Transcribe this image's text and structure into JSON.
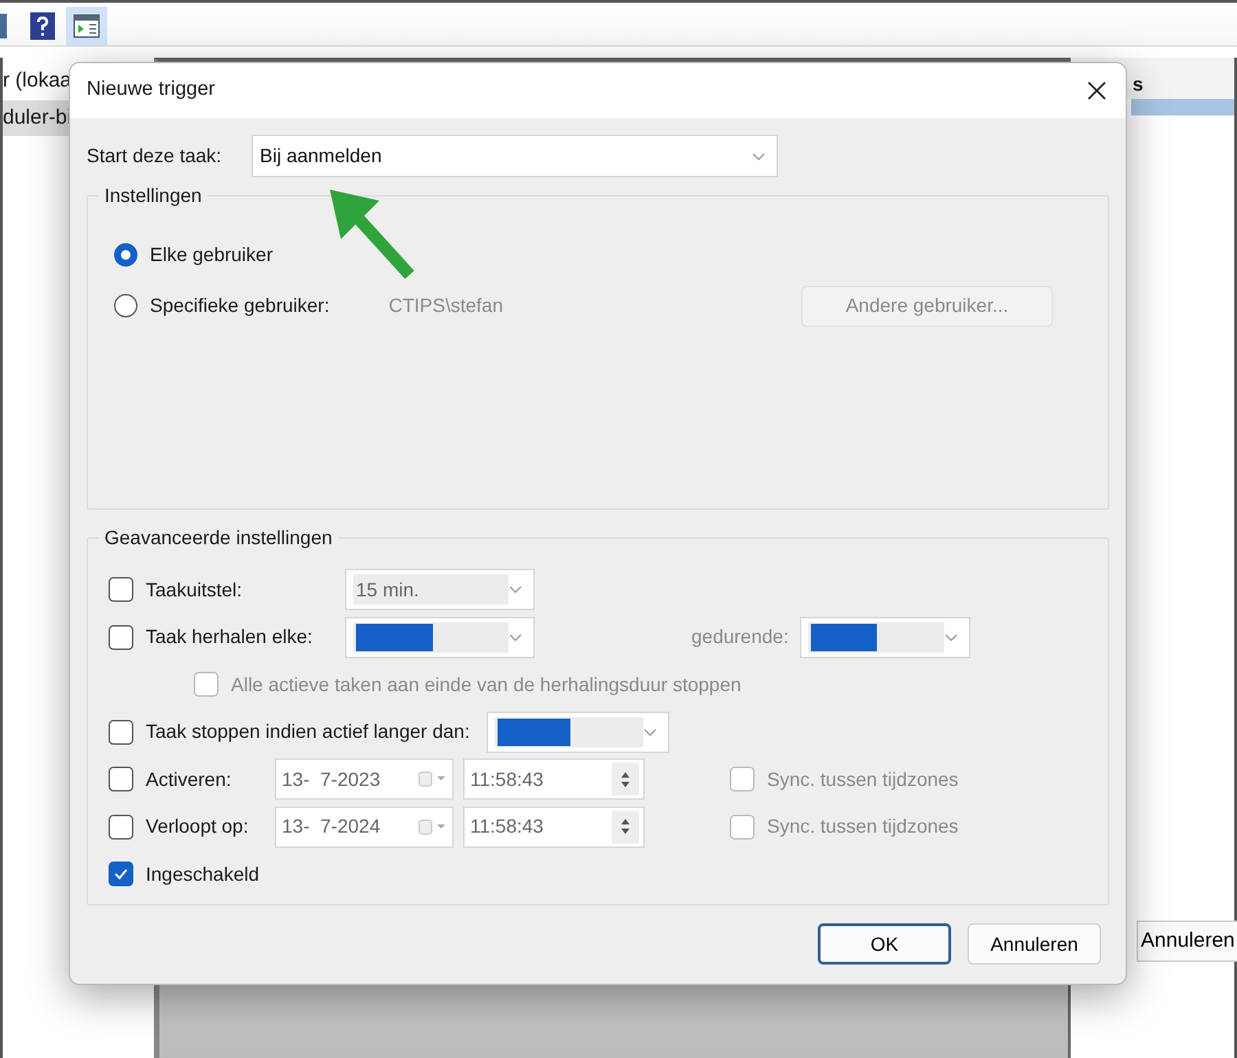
{
  "background_window": {
    "left_pane_items": [
      {
        "label": "r (lokaa",
        "selected": false
      },
      {
        "label": "duler-bi",
        "selected": true
      }
    ],
    "right_pane_header": "s",
    "right_button": "Annuleren"
  },
  "dialog": {
    "title": "Nieuwe trigger",
    "start": {
      "label": "Start deze taak:",
      "value": "Bij aanmelden"
    },
    "settings": {
      "legend": "Instellingen",
      "options": [
        {
          "label": "Elke gebruiker",
          "selected": true
        },
        {
          "label": "Specifieke gebruiker:",
          "selected": false
        }
      ],
      "user": "CTIPS\\stefan",
      "user_button": {
        "label": "Andere gebruiker...",
        "disabled": true
      }
    },
    "advanced": {
      "legend": "Geavanceerde instellingen",
      "rows": [
        {
          "kind": "select",
          "label": "Taakuitstel:",
          "checked": false,
          "value": "15 min.",
          "highlighted": false
        },
        {
          "kind": "repeat",
          "label": "Taak herhalen elke:",
          "checked": false,
          "highlighted": true,
          "duration_label": "gedurende:",
          "duration_highlighted": true
        },
        {
          "kind": "subcheck",
          "label": "Alle actieve taken aan einde van de herhalingsduur stoppen",
          "checked": false,
          "disabled": true
        },
        {
          "kind": "select",
          "label": "Taak stoppen indien actief langer dan:",
          "checked": false,
          "highlighted": true
        },
        {
          "kind": "datetime",
          "label": "Activeren:",
          "checked": false,
          "date": "13-  7-2023",
          "time": "11:58:43",
          "sync": {
            "label": "Sync. tussen tijdzones",
            "checked": false,
            "disabled": true
          }
        },
        {
          "kind": "datetime",
          "label": "Verloopt op:",
          "checked": false,
          "date": "13-  7-2024",
          "time": "11:58:43",
          "sync": {
            "label": "Sync. tussen tijdzones",
            "checked": false,
            "disabled": true
          }
        },
        {
          "kind": "check",
          "label": "Ingeschakeld",
          "checked": true
        }
      ]
    },
    "buttons": [
      {
        "label": "OK",
        "default": true
      },
      {
        "label": "Annuleren",
        "default": false
      }
    ]
  }
}
